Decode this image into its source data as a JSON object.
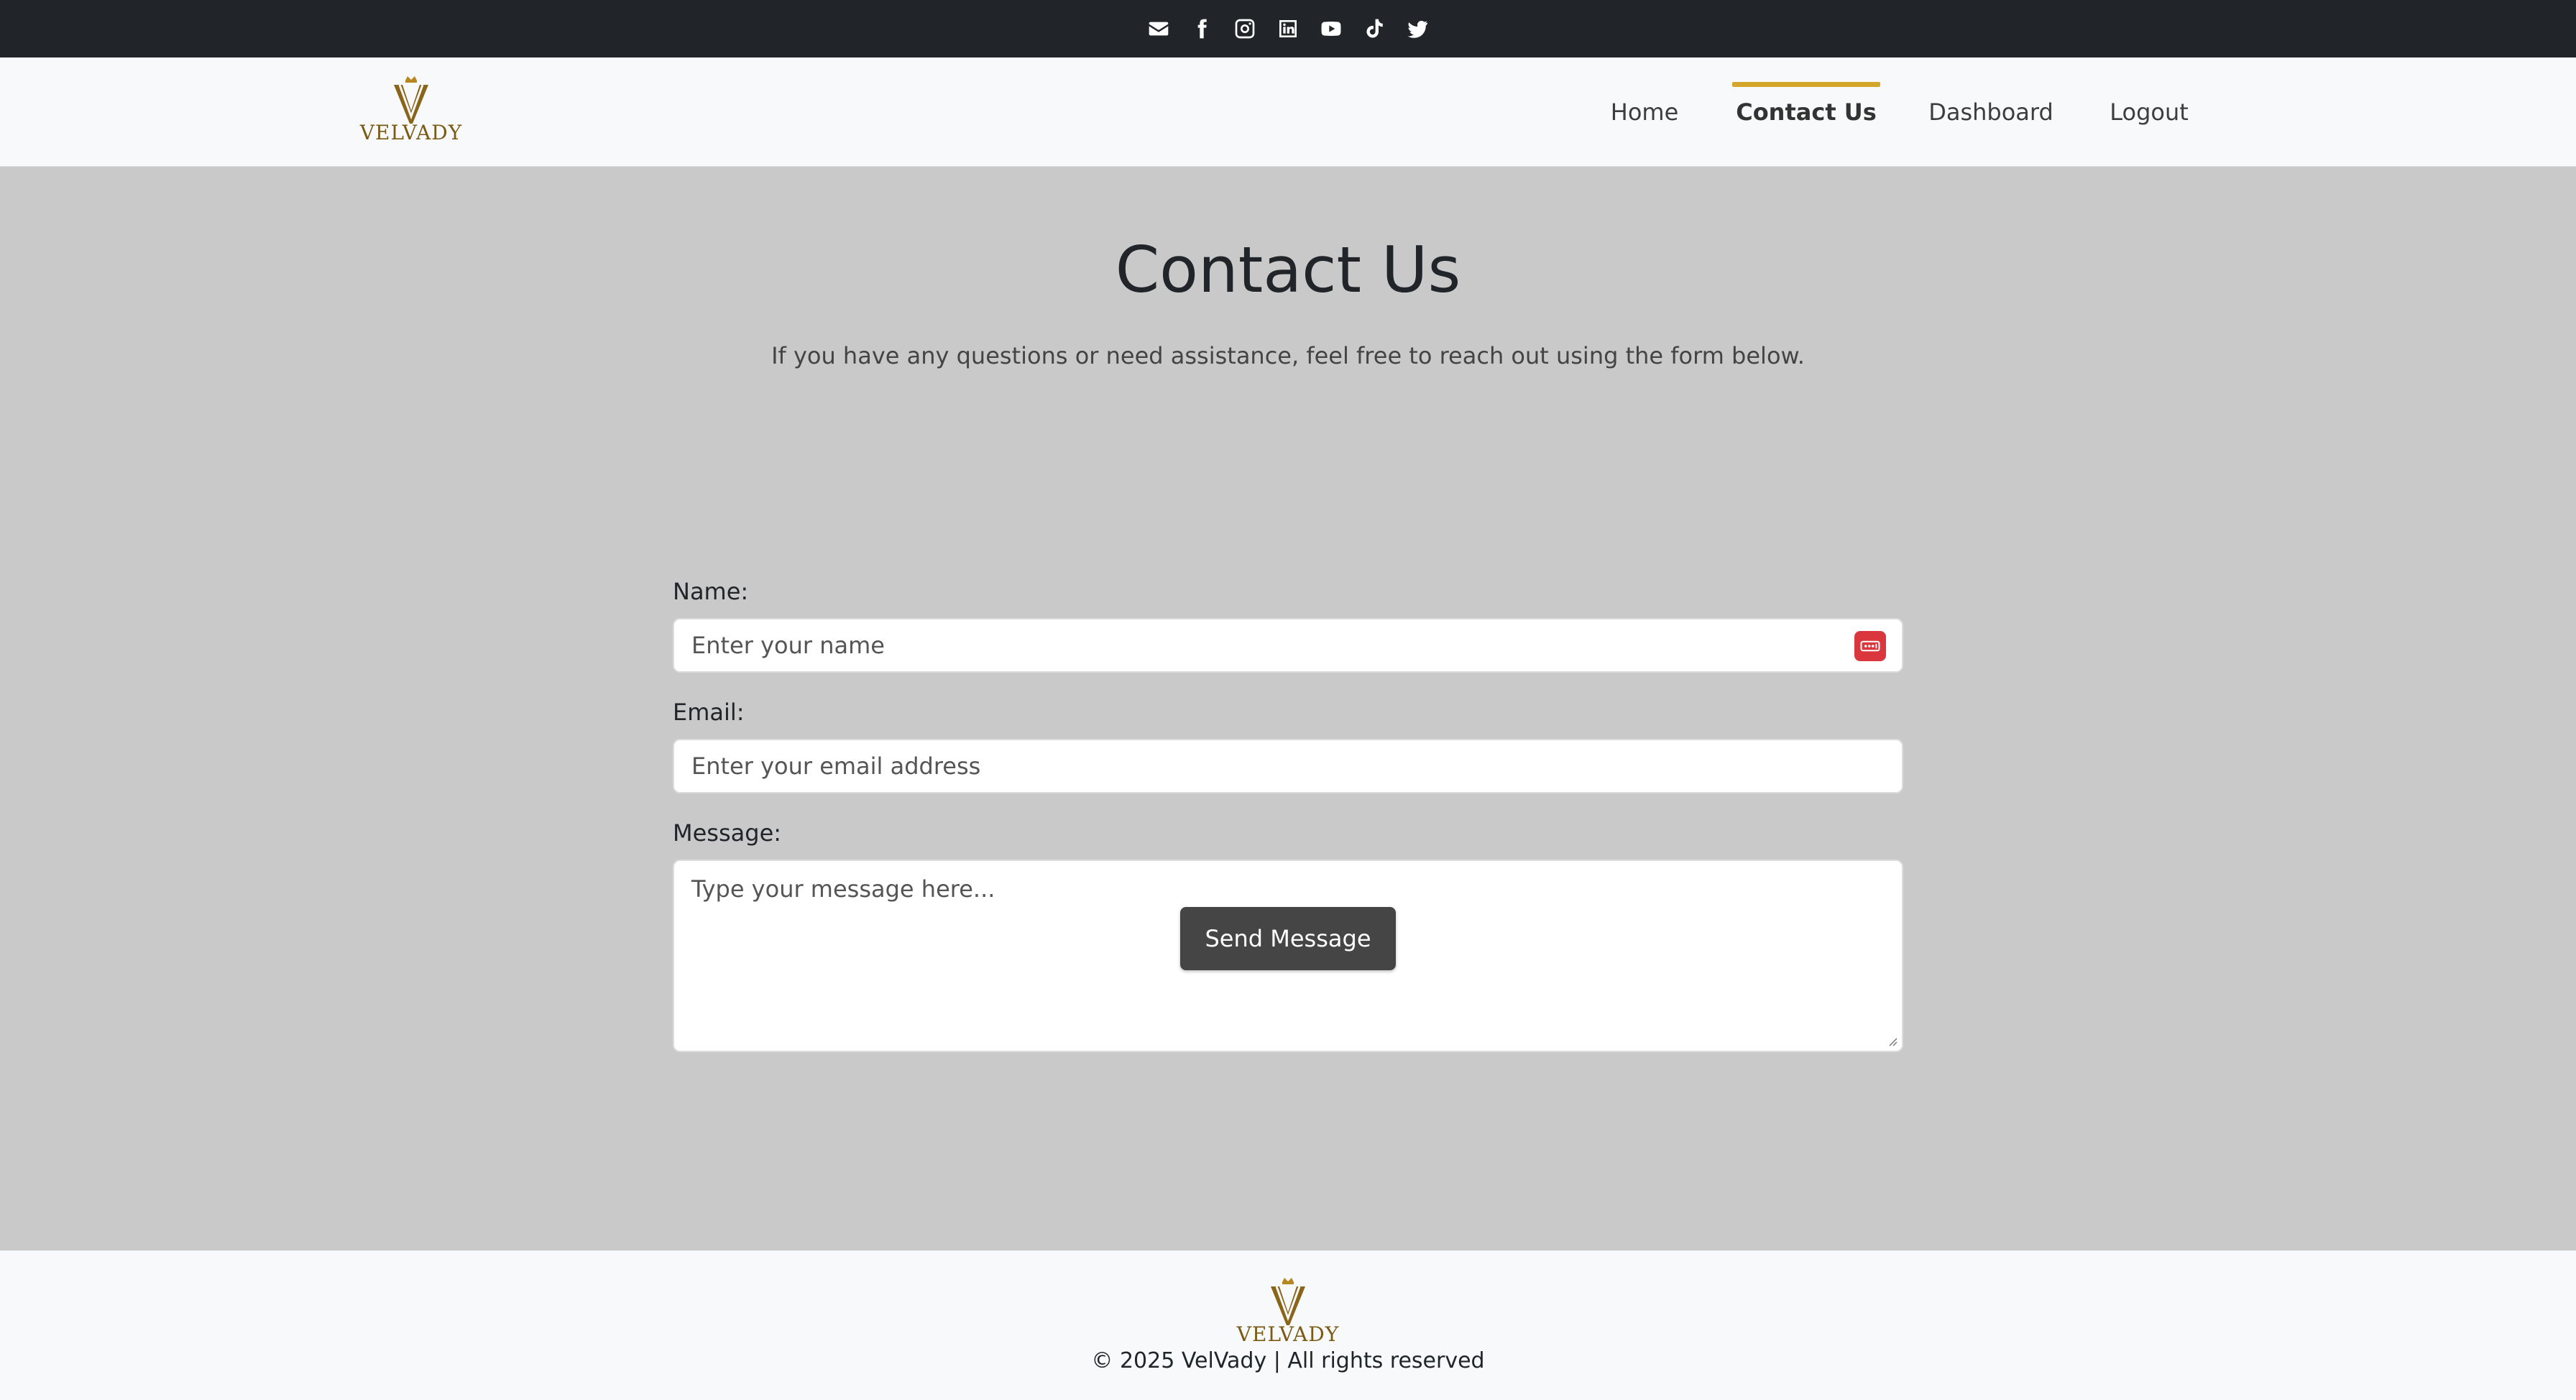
{
  "social": {
    "icons": [
      "envelope-icon",
      "facebook-icon",
      "instagram-icon",
      "linkedin-icon",
      "youtube-icon",
      "tiktok-icon",
      "twitter-icon"
    ]
  },
  "brand": {
    "name": "VELVADY"
  },
  "nav": {
    "items": [
      {
        "label": "Home",
        "active": false
      },
      {
        "label": "Contact Us",
        "active": true
      },
      {
        "label": "Dashboard",
        "active": false
      },
      {
        "label": "Logout",
        "active": false
      }
    ]
  },
  "page": {
    "title": "Contact Us",
    "intro": "If you have any questions or need assistance, feel free to reach out using the form below."
  },
  "form": {
    "name_label": "Name:",
    "name_placeholder": "Enter your name",
    "email_label": "Email:",
    "email_placeholder": "Enter your email address",
    "message_label": "Message:",
    "message_placeholder": "Type your message here...",
    "submit_label": "Send Message"
  },
  "footer": {
    "copyright": "© 2025 VelVady | All rights reserved"
  },
  "colors": {
    "topbar": "#212529",
    "navbar": "#f8f9fa",
    "page_background": "#c9c9c9",
    "active_accent": "#d4a72c",
    "brand_gold": "#7a5a14",
    "button": "#454545",
    "password_manager_icon": "#d9363e"
  }
}
